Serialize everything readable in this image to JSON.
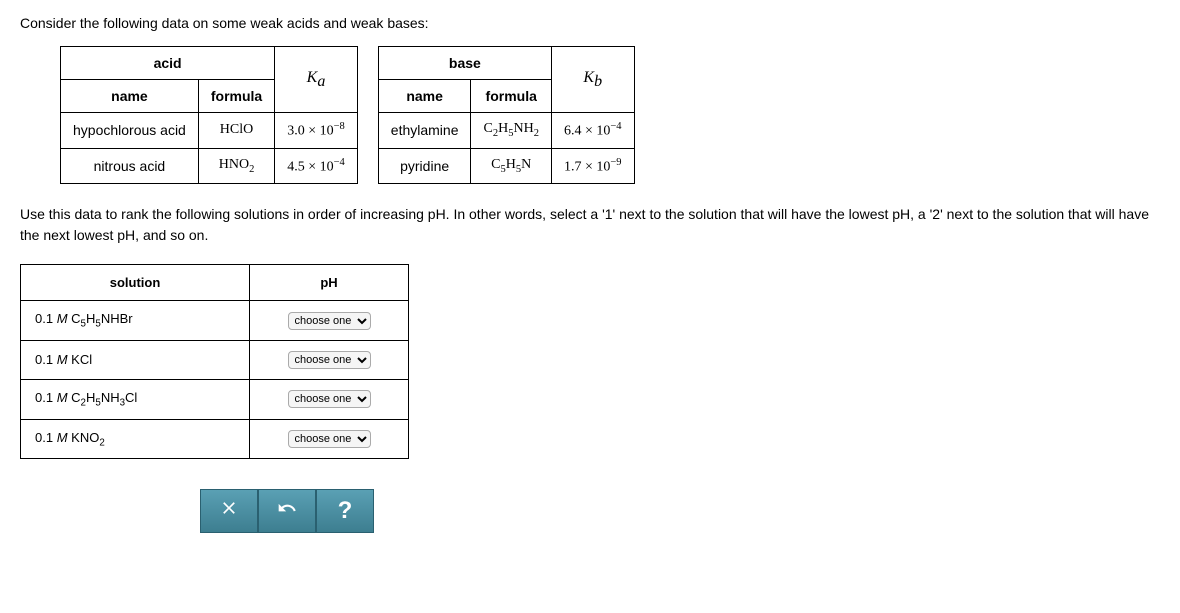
{
  "intro": "Consider the following data on some weak acids and weak bases:",
  "acid_table": {
    "head_main": "acid",
    "head_name": "name",
    "head_formula": "formula",
    "head_k": "K",
    "head_k_sub": "a",
    "rows": [
      {
        "name": "hypochlorous acid",
        "formula_html": "HClO",
        "k_base": "3.0 × 10",
        "k_exp": "−8"
      },
      {
        "name": "nitrous acid",
        "formula_html": "HNO",
        "formula_sub": "2",
        "k_base": "4.5 × 10",
        "k_exp": "−4"
      }
    ]
  },
  "base_table": {
    "head_main": "base",
    "head_name": "name",
    "head_formula": "formula",
    "head_k": "K",
    "head_k_sub": "b",
    "rows": [
      {
        "name": "ethylamine",
        "formula_pre": "C",
        "formula_sub1": "2",
        "formula_mid": "H",
        "formula_sub2": "5",
        "formula_post": "NH",
        "formula_sub3": "2",
        "k_base": "6.4 × 10",
        "k_exp": "−4"
      },
      {
        "name": "pyridine",
        "formula_pre": "C",
        "formula_sub1": "5",
        "formula_mid": "H",
        "formula_sub2": "5",
        "formula_post": "N",
        "k_base": "1.7 × 10",
        "k_exp": "−9"
      }
    ]
  },
  "instructions": "Use this data to rank the following solutions in order of increasing pH. In other words, select a '1' next to the solution that will have the lowest pH, a '2' next to the solution that will have the next lowest pH, and so on.",
  "answer_table": {
    "head_solution": "solution",
    "head_ph": "pH",
    "choose_label": "choose one",
    "rows": [
      {
        "conc": "0.1",
        "m": "M",
        "formula": "C5H5NHBr"
      },
      {
        "conc": "0.1",
        "m": "M",
        "formula": "KCl"
      },
      {
        "conc": "0.1",
        "m": "M",
        "formula": "C2H5NH3Cl"
      },
      {
        "conc": "0.1",
        "m": "M",
        "formula": "KNO2"
      }
    ]
  },
  "buttons": {
    "clear": "×",
    "reset": "↶",
    "help": "?"
  }
}
